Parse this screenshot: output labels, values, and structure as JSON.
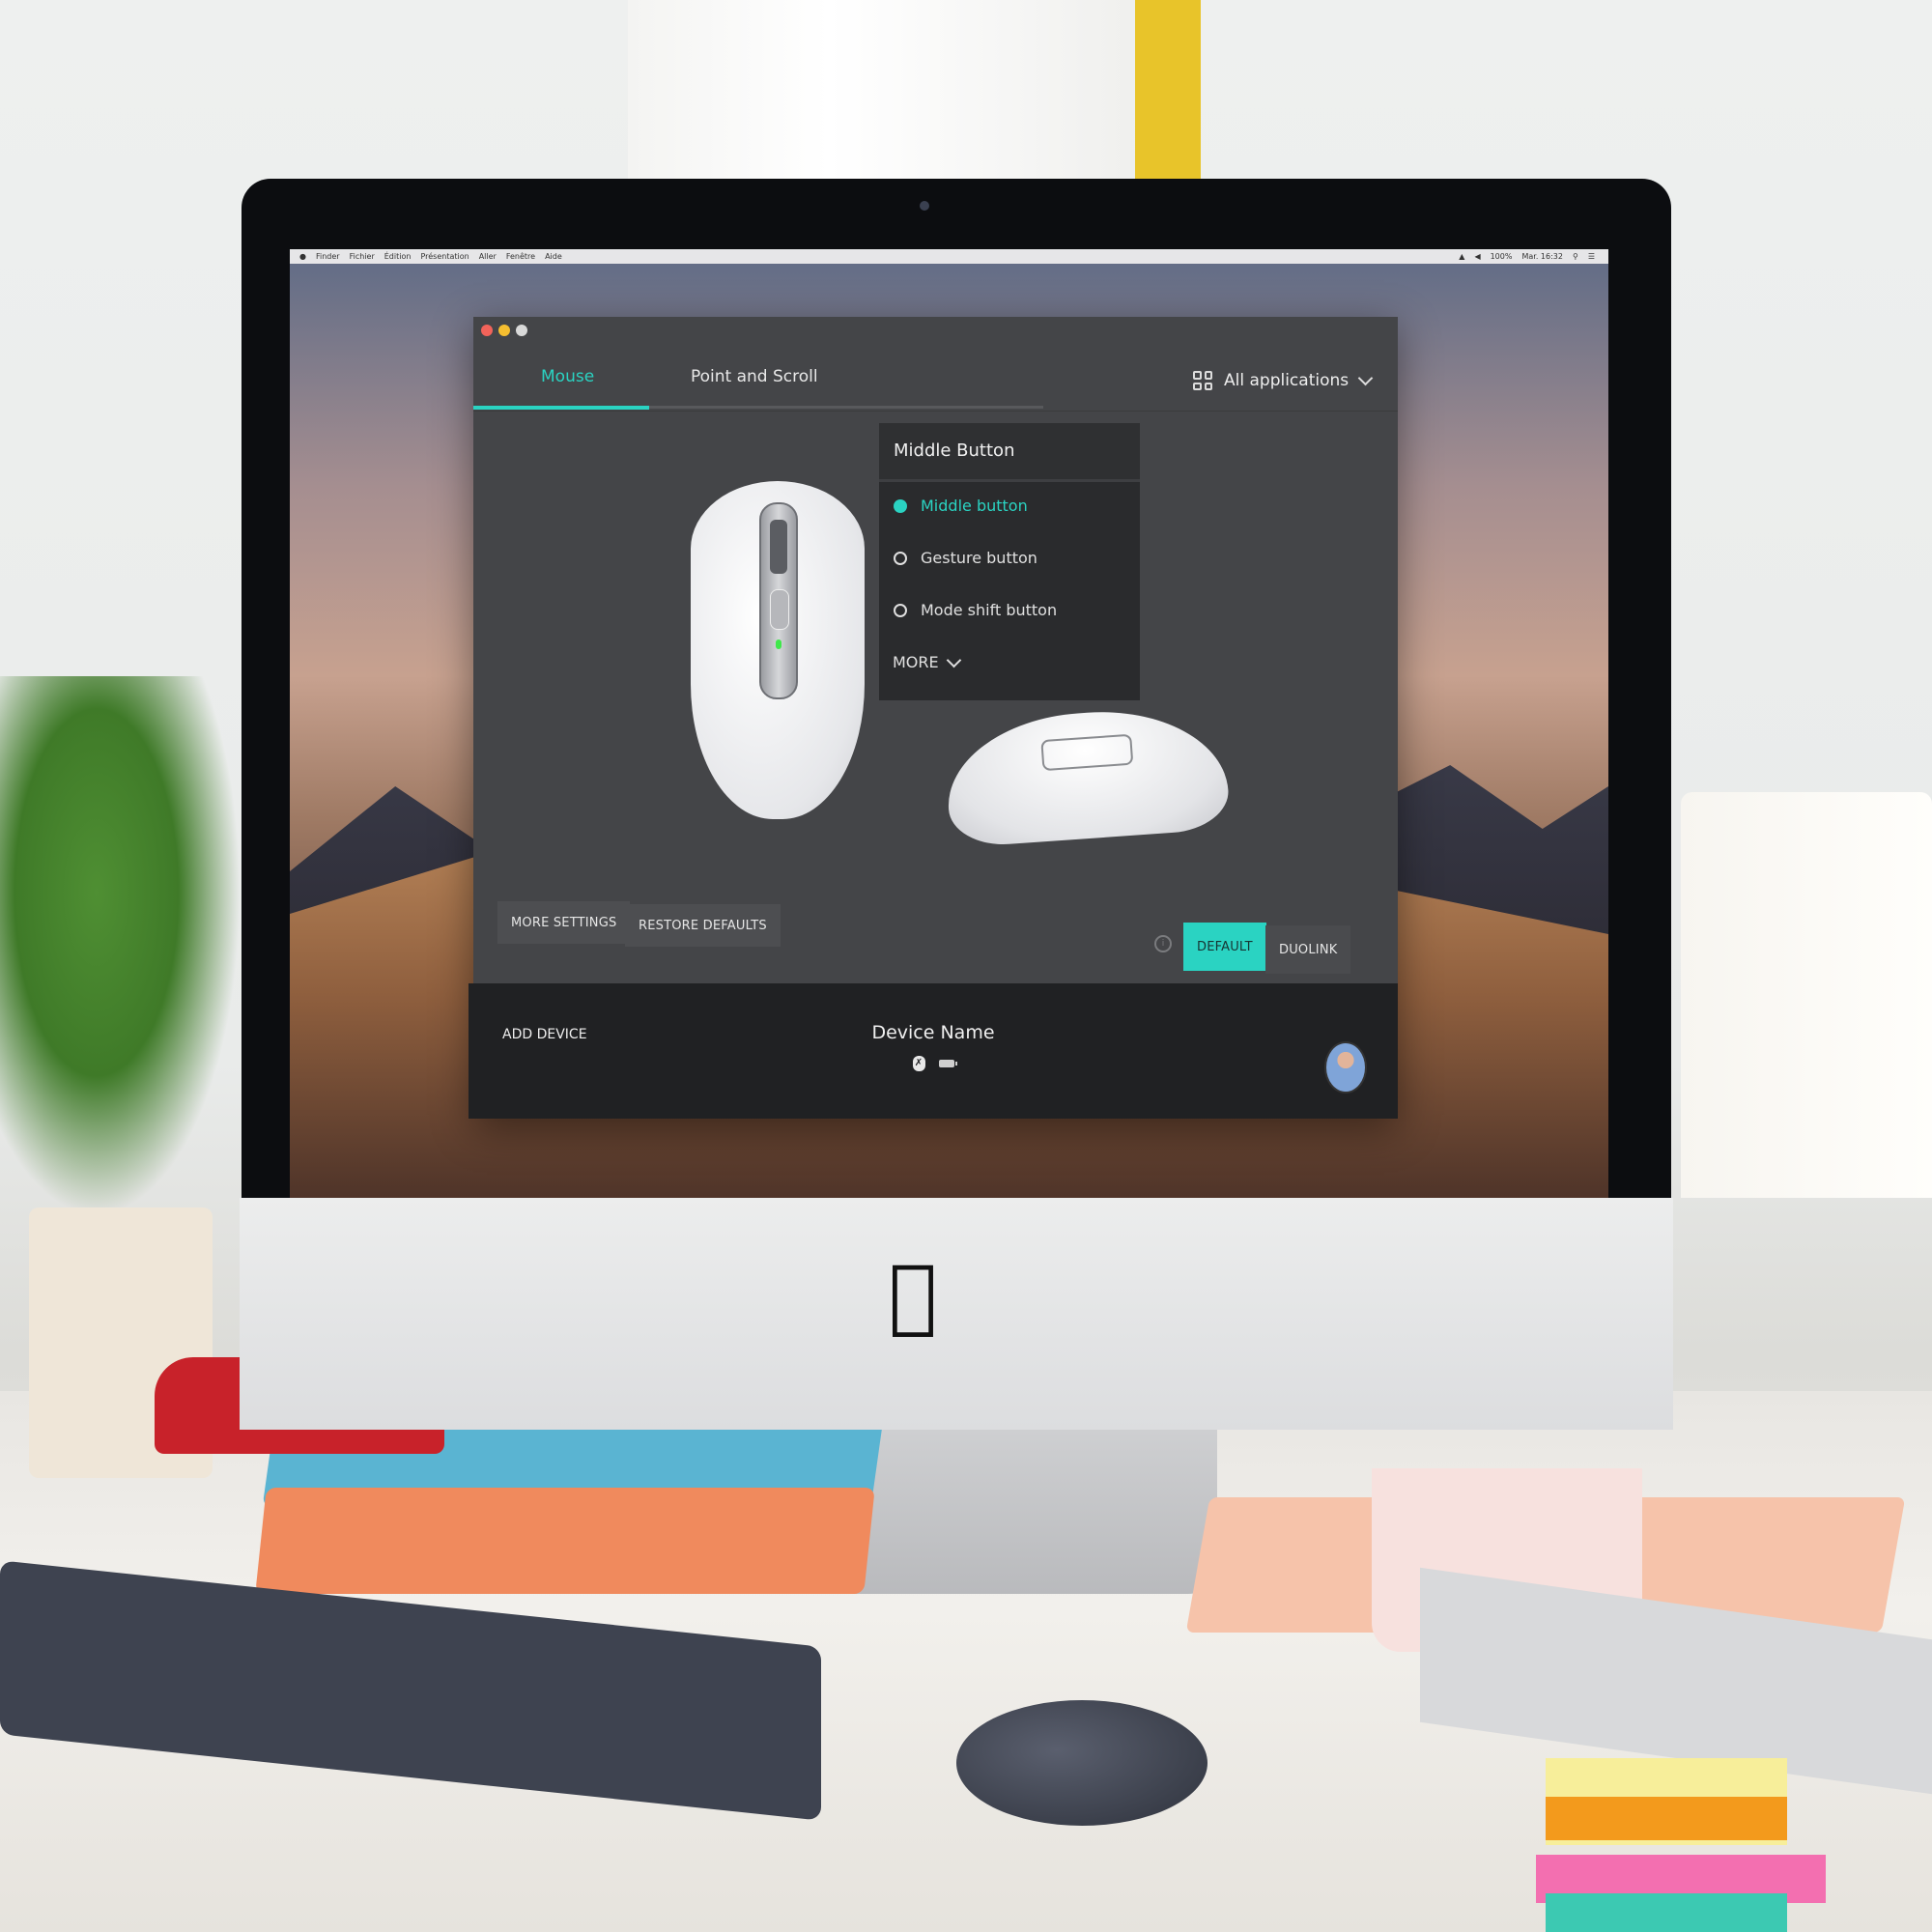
{
  "menubar": {
    "apple_icon": "apple-icon",
    "items": [
      "Finder",
      "Fichier",
      "Édition",
      "Présentation",
      "Aller",
      "Fenêtre",
      "Aide"
    ],
    "status": {
      "battery": "100%",
      "clock": "Mar. 16:32"
    }
  },
  "app": {
    "tabs": [
      {
        "label": "Mouse",
        "active": true
      },
      {
        "label": "Point and Scroll",
        "active": false
      }
    ],
    "app_selector": {
      "label": "All applications",
      "icon": "grid-icon"
    },
    "button_panel": {
      "title": "Middle Button",
      "options": [
        {
          "label": "Middle button",
          "selected": true
        },
        {
          "label": "Gesture button",
          "selected": false
        },
        {
          "label": "Mode shift button",
          "selected": false
        }
      ],
      "more_label": "MORE"
    },
    "buttons": {
      "more_settings": "MORE SETTINGS",
      "restore_defaults": "RESTORE DEFAULTS",
      "default": "DEFAULT",
      "duolink": "DUOLINK"
    },
    "footer": {
      "add_device": "ADD DEVICE",
      "device_name": "Device Name"
    },
    "accent_color": "#2ad3c2"
  }
}
